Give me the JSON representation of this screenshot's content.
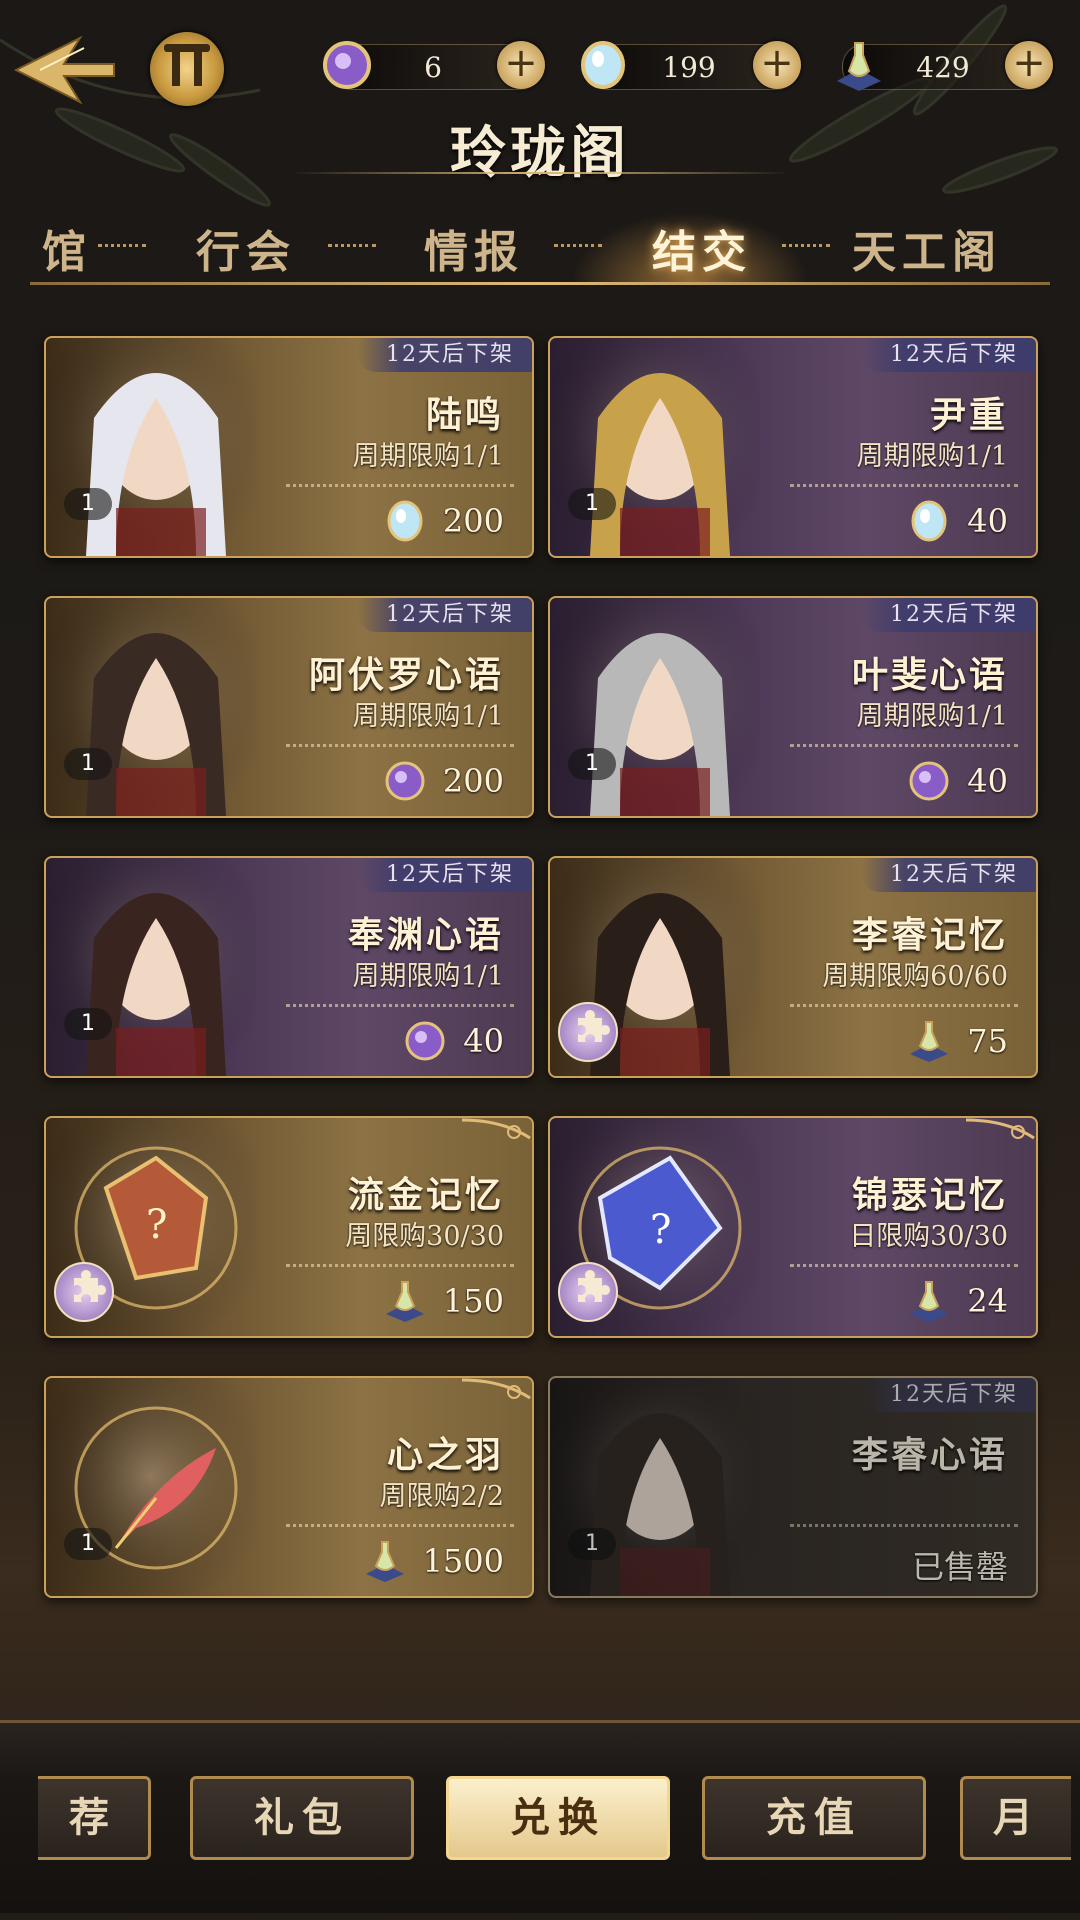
{
  "header": {
    "title": "玲珑阁",
    "currencies": [
      {
        "icon": "purple-gem-icon",
        "value": "6"
      },
      {
        "icon": "blue-crystal-icon",
        "value": "199"
      },
      {
        "icon": "potion-icon",
        "value": "429"
      }
    ]
  },
  "tabs": [
    {
      "label": "馆",
      "active": false
    },
    {
      "label": "行会",
      "active": false
    },
    {
      "label": "情报",
      "active": false
    },
    {
      "label": "结交",
      "active": true
    },
    {
      "label": "天工阁",
      "active": false
    }
  ],
  "items": [
    {
      "name": "陆鸣",
      "deadline": "12天后下架",
      "limit": "周期限购1/1",
      "price": "200",
      "currency": "blue-crystal-icon",
      "badge": "1",
      "style": "gold"
    },
    {
      "name": "尹重",
      "deadline": "12天后下架",
      "limit": "周期限购1/1",
      "price": "40",
      "currency": "blue-crystal-icon",
      "badge": "1",
      "style": "purple"
    },
    {
      "name": "阿伏罗心语",
      "deadline": "12天后下架",
      "limit": "周期限购1/1",
      "price": "200",
      "currency": "purple-gem-icon",
      "badge": "1",
      "style": "gold"
    },
    {
      "name": "叶斐心语",
      "deadline": "12天后下架",
      "limit": "周期限购1/1",
      "price": "40",
      "currency": "purple-gem-icon",
      "badge": "1",
      "style": "purple"
    },
    {
      "name": "奉渊心语",
      "deadline": "12天后下架",
      "limit": "周期限购1/1",
      "price": "40",
      "currency": "purple-gem-icon",
      "badge": "1",
      "style": "purple"
    },
    {
      "name": "李睿记忆",
      "deadline": "12天后下架",
      "limit": "周期限购60/60",
      "price": "75",
      "currency": "potion-icon",
      "badge": "puzzle",
      "style": "gold"
    },
    {
      "name": "流金记忆",
      "deadline": "",
      "limit": "周限购30/30",
      "price": "150",
      "currency": "potion-icon",
      "badge": "puzzle",
      "style": "gold"
    },
    {
      "name": "锦瑟记忆",
      "deadline": "",
      "limit": "日限购30/30",
      "price": "24",
      "currency": "potion-icon",
      "badge": "puzzle",
      "style": "purple"
    },
    {
      "name": "心之羽",
      "deadline": "",
      "limit": "周限购2/2",
      "price": "1500",
      "currency": "potion-icon",
      "badge": "1",
      "style": "gold"
    },
    {
      "name": "李睿心语",
      "deadline": "12天后下架",
      "limit": "",
      "price": "",
      "sold_label": "已售罄",
      "currency": "",
      "badge": "1",
      "style": "sold"
    }
  ],
  "bottom_tabs": [
    {
      "label": "荐",
      "active": false
    },
    {
      "label": "礼包",
      "active": false
    },
    {
      "label": "兑换",
      "active": true
    },
    {
      "label": "充值",
      "active": false
    },
    {
      "label": "月",
      "active": false
    }
  ]
}
